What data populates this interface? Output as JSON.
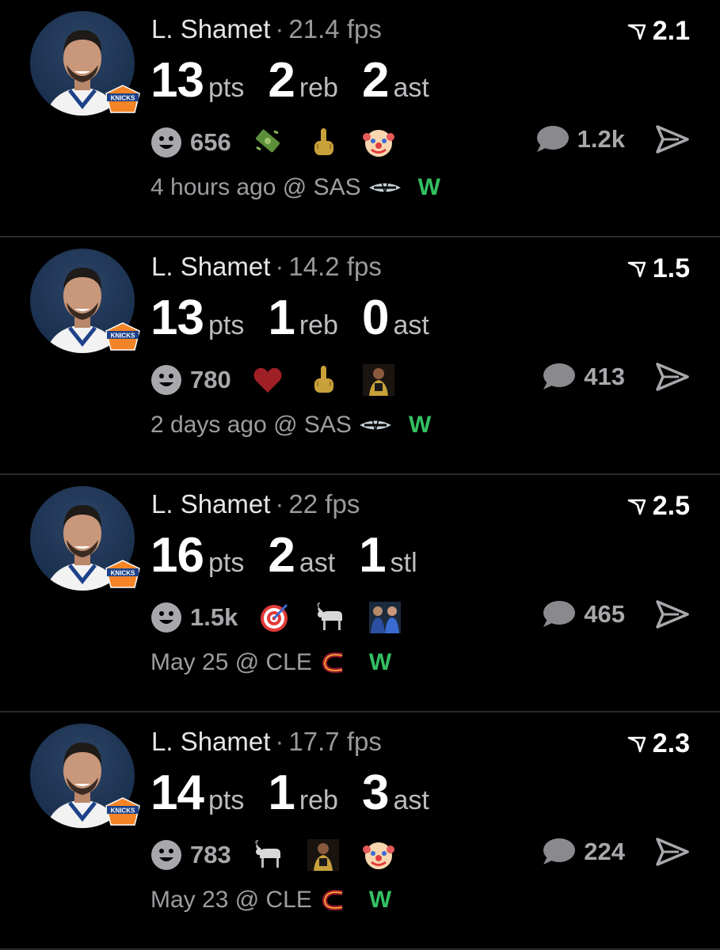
{
  "colors": {
    "background": "#000000",
    "win": "#33c061",
    "muted": "#9d9da1"
  },
  "posts": [
    {
      "name": "L. Shamet",
      "fps": "21.4 fps",
      "score": "2.1",
      "stats": [
        {
          "num": "13",
          "label": "pts"
        },
        {
          "num": "2",
          "label": "reb"
        },
        {
          "num": "2",
          "label": "ast"
        }
      ],
      "react_count": "656",
      "emojis": [
        "money-icon",
        "middle-finger-icon",
        "clown-icon"
      ],
      "comments": "1.2k",
      "time": "4 hours ago @ SAS",
      "team_logo": "spurs-logo",
      "result": "W"
    },
    {
      "name": "L. Shamet",
      "fps": "14.2 fps",
      "score": "1.5",
      "stats": [
        {
          "num": "13",
          "label": "pts"
        },
        {
          "num": "1",
          "label": "reb"
        },
        {
          "num": "0",
          "label": "ast"
        }
      ],
      "react_count": "780",
      "emojis": [
        "heart-icon",
        "middle-finger-icon",
        "player-icon"
      ],
      "comments": "413",
      "time": "2 days ago @ SAS",
      "team_logo": "spurs-logo",
      "result": "W"
    },
    {
      "name": "L. Shamet",
      "fps": "22 fps",
      "score": "2.5",
      "stats": [
        {
          "num": "16",
          "label": "pts"
        },
        {
          "num": "2",
          "label": "ast"
        },
        {
          "num": "1",
          "label": "stl"
        }
      ],
      "react_count": "1.5k",
      "emojis": [
        "target-icon",
        "goat-icon",
        "coaches-icon"
      ],
      "comments": "465",
      "time": "May 25 @ CLE",
      "team_logo": "cavaliers-logo",
      "result": "W"
    },
    {
      "name": "L. Shamet",
      "fps": "17.7 fps",
      "score": "2.3",
      "stats": [
        {
          "num": "14",
          "label": "pts"
        },
        {
          "num": "1",
          "label": "reb"
        },
        {
          "num": "3",
          "label": "ast"
        }
      ],
      "react_count": "783",
      "emojis": [
        "goat-icon",
        "player-icon",
        "clown-icon"
      ],
      "comments": "224",
      "time": "May 23 @ CLE",
      "team_logo": "cavaliers-logo",
      "result": "W"
    }
  ]
}
